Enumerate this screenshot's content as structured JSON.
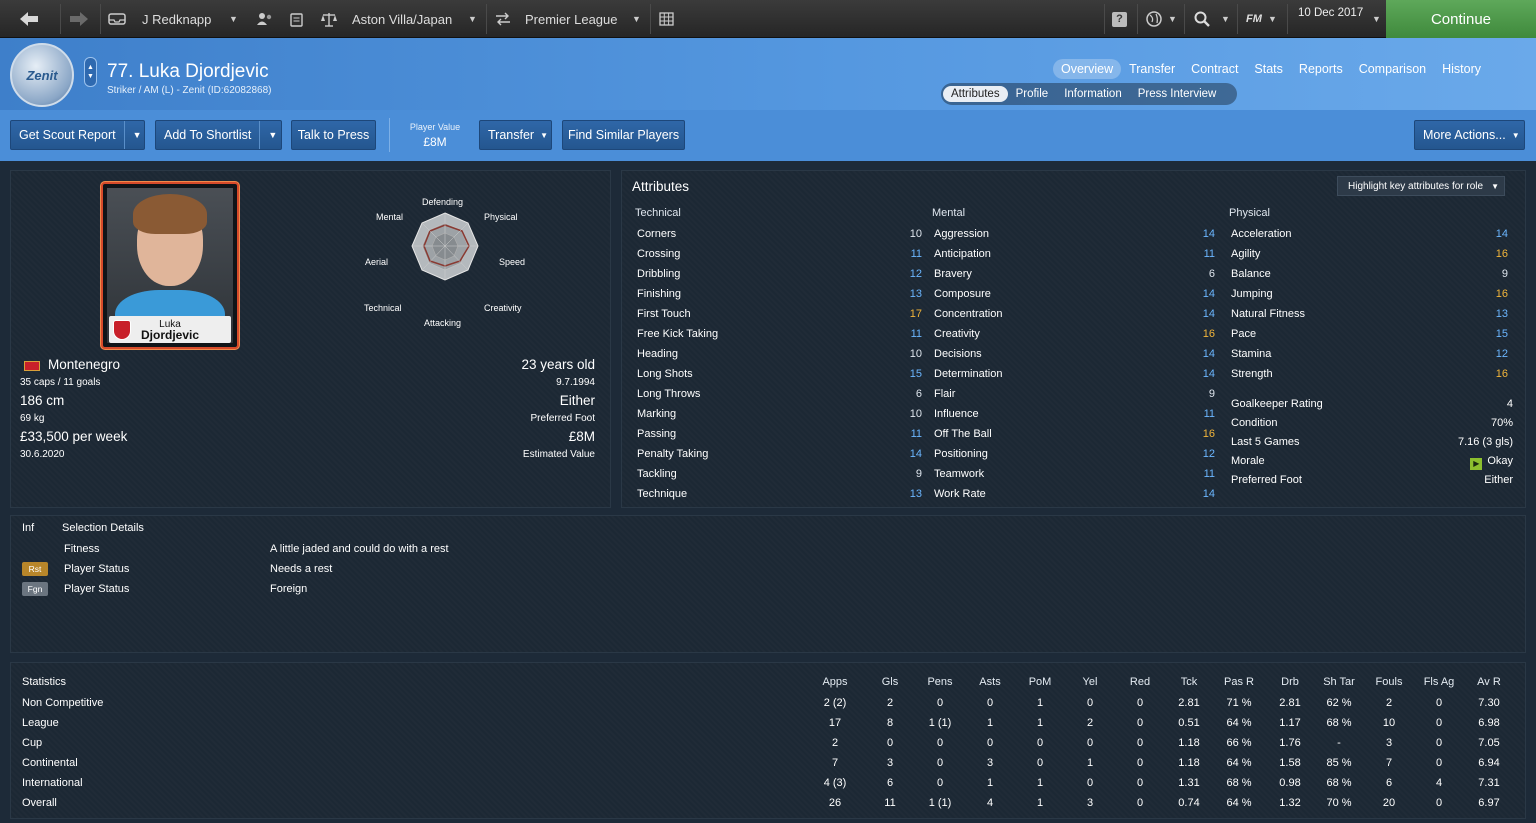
{
  "topbar": {
    "manager": "J Redknapp",
    "club": "Aston Villa/Japan",
    "competition": "Premier League",
    "date": "10 Dec 2017",
    "continue_label": "Continue",
    "fm_label": "FM"
  },
  "header": {
    "club_logo_text": "Zenit",
    "player_name": "77. Luka Djordjevic",
    "player_sub": "Striker / AM (L) - Zenit (ID:62082868)",
    "nav_tabs": [
      "Overview",
      "Transfer",
      "Contract",
      "Stats",
      "Reports",
      "Comparison",
      "History"
    ],
    "sub_tabs": [
      "Attributes",
      "Profile",
      "Information",
      "Press Interview"
    ]
  },
  "actions": {
    "scout": "Get Scout Report",
    "shortlist": "Add To Shortlist",
    "press": "Talk to Press",
    "player_value_label": "Player Value",
    "player_value": "£8M",
    "transfer": "Transfer",
    "similar": "Find Similar Players",
    "more": "More Actions..."
  },
  "profile": {
    "photo_first": "Luka",
    "photo_last": "Djordjevic",
    "nationality": "Montenegro",
    "caps": "35 caps / 11 goals",
    "height": "186 cm",
    "weight": "69 kg",
    "wage": "£33,500 per week",
    "contract_end": "30.6.2020",
    "age": "23 years old",
    "dob": "9.7.1994",
    "foot": "Either",
    "foot_label": "Preferred Foot",
    "est_value": "£8M",
    "est_value_label": "Estimated Value"
  },
  "radar": {
    "labels": {
      "defending": "Defending",
      "physical": "Physical",
      "speed": "Speed",
      "creativity": "Creativity",
      "attacking": "Attacking",
      "technical": "Technical",
      "aerial": "Aerial",
      "mental": "Mental"
    }
  },
  "attributes": {
    "title": "Attributes",
    "highlight_label": "Highlight key attributes for role",
    "technical_title": "Technical",
    "mental_title": "Mental",
    "physical_title": "Physical",
    "technical": [
      {
        "name": "Corners",
        "value": "10"
      },
      {
        "name": "Crossing",
        "value": "11"
      },
      {
        "name": "Dribbling",
        "value": "12"
      },
      {
        "name": "Finishing",
        "value": "13"
      },
      {
        "name": "First Touch",
        "value": "17"
      },
      {
        "name": "Free Kick Taking",
        "value": "11"
      },
      {
        "name": "Heading",
        "value": "10"
      },
      {
        "name": "Long Shots",
        "value": "15"
      },
      {
        "name": "Long Throws",
        "value": "6"
      },
      {
        "name": "Marking",
        "value": "10"
      },
      {
        "name": "Passing",
        "value": "11"
      },
      {
        "name": "Penalty Taking",
        "value": "14"
      },
      {
        "name": "Tackling",
        "value": "9"
      },
      {
        "name": "Technique",
        "value": "13"
      }
    ],
    "mental": [
      {
        "name": "Aggression",
        "value": "14"
      },
      {
        "name": "Anticipation",
        "value": "11"
      },
      {
        "name": "Bravery",
        "value": "6"
      },
      {
        "name": "Composure",
        "value": "14"
      },
      {
        "name": "Concentration",
        "value": "14"
      },
      {
        "name": "Creativity",
        "value": "16"
      },
      {
        "name": "Decisions",
        "value": "14"
      },
      {
        "name": "Determination",
        "value": "14"
      },
      {
        "name": "Flair",
        "value": "9"
      },
      {
        "name": "Influence",
        "value": "11"
      },
      {
        "name": "Off The Ball",
        "value": "16"
      },
      {
        "name": "Positioning",
        "value": "12"
      },
      {
        "name": "Teamwork",
        "value": "11"
      },
      {
        "name": "Work Rate",
        "value": "14"
      }
    ],
    "physical": [
      {
        "name": "Acceleration",
        "value": "14"
      },
      {
        "name": "Agility",
        "value": "16"
      },
      {
        "name": "Balance",
        "value": "9"
      },
      {
        "name": "Jumping",
        "value": "16"
      },
      {
        "name": "Natural Fitness",
        "value": "13"
      },
      {
        "name": "Pace",
        "value": "15"
      },
      {
        "name": "Stamina",
        "value": "12"
      },
      {
        "name": "Strength",
        "value": "16"
      }
    ],
    "extra": [
      {
        "name": "Goalkeeper Rating",
        "value": "4"
      },
      {
        "name": "Condition",
        "value": "70%"
      },
      {
        "name": "Last 5 Games",
        "value": "7.16 (3 gls)"
      },
      {
        "name": "Morale",
        "value": "Okay"
      },
      {
        "name": "Preferred Foot",
        "value": "Either"
      }
    ]
  },
  "selection": {
    "inf_label": "Inf",
    "title": "Selection Details",
    "rows": [
      {
        "tag": "",
        "label": "Fitness",
        "value": "A little jaded and could do with a rest"
      },
      {
        "tag": "Rst",
        "label": "Player Status",
        "value": "Needs a rest"
      },
      {
        "tag": "Fgn",
        "label": "Player Status",
        "value": "Foreign"
      }
    ],
    "colors": {
      "rst": "#b8862a",
      "fgn": "#6b7580"
    }
  },
  "statistics": {
    "title": "Statistics",
    "columns": [
      "Apps",
      "Gls",
      "Pens",
      "Asts",
      "PoM",
      "Yel",
      "Red",
      "Tck",
      "Pas R",
      "Drb",
      "Sh Tar",
      "Fouls",
      "Fls Ag",
      "Av R"
    ],
    "rows": [
      {
        "label": "Non Competitive",
        "cells": [
          "2 (2)",
          "2",
          "0",
          "0",
          "1",
          "0",
          "0",
          "2.81",
          "71 %",
          "2.81",
          "62 %",
          "2",
          "0",
          "7.30"
        ]
      },
      {
        "label": "League",
        "cells": [
          "17",
          "8",
          "1 (1)",
          "1",
          "1",
          "2",
          "0",
          "0.51",
          "64 %",
          "1.17",
          "68 %",
          "10",
          "0",
          "6.98"
        ]
      },
      {
        "label": "Cup",
        "cells": [
          "2",
          "0",
          "0",
          "0",
          "0",
          "0",
          "0",
          "1.18",
          "66 %",
          "1.76",
          "-",
          "3",
          "0",
          "7.05"
        ]
      },
      {
        "label": "Continental",
        "cells": [
          "7",
          "3",
          "0",
          "3",
          "0",
          "1",
          "0",
          "1.18",
          "64 %",
          "1.58",
          "85 %",
          "7",
          "0",
          "6.94"
        ]
      },
      {
        "label": "International",
        "cells": [
          "4 (3)",
          "6",
          "0",
          "1",
          "1",
          "0",
          "0",
          "1.31",
          "68 %",
          "0.98",
          "68 %",
          "6",
          "4",
          "7.31"
        ]
      },
      {
        "label": "Overall",
        "cells": [
          "26",
          "11",
          "1 (1)",
          "4",
          "1",
          "3",
          "0",
          "0.74",
          "64 %",
          "1.32",
          "70 %",
          "20",
          "0",
          "6.97"
        ]
      }
    ]
  },
  "colors": {
    "accent": "#4b8ed8",
    "continue": "#4f9a4b",
    "attr_low": "#dfe6ee",
    "attr_mid": "#6bb6ff",
    "attr_high": "#f2b53a"
  }
}
